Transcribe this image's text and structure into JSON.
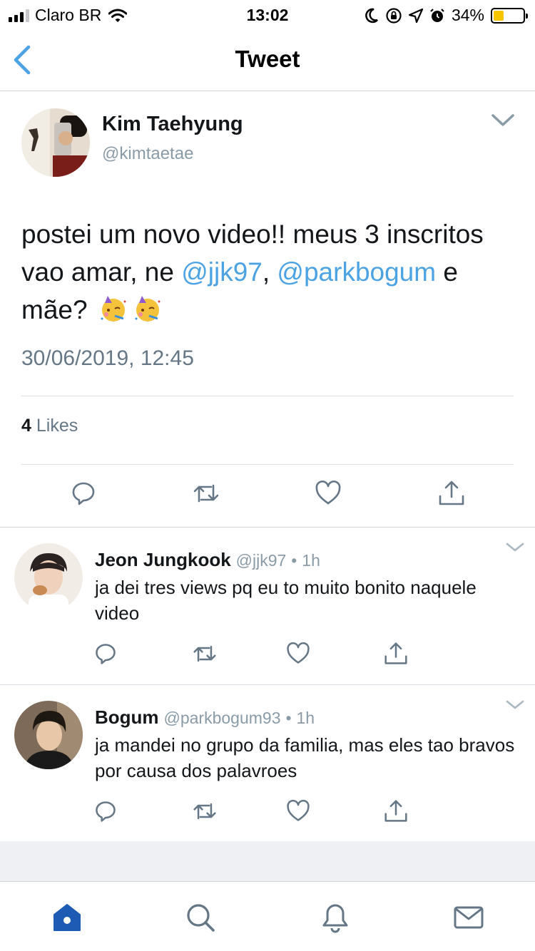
{
  "status_bar": {
    "carrier": "Claro BR",
    "time": "13:02",
    "battery_percent": "34%",
    "battery_level": 0.34
  },
  "nav": {
    "title": "Tweet"
  },
  "main_tweet": {
    "author_name": "Kim Taehyung",
    "author_handle": "@kimtaetae",
    "text_parts": {
      "p1": "postei um novo video!! meus 3 inscritos vao amar, ne ",
      "mention1": "@jjk97",
      "p2": ", ",
      "mention2": "@parkbogum",
      "p3": " e mãe?"
    },
    "emoji": "partying-face-emoji",
    "timestamp": "30/06/2019, 12:45",
    "likes_count": "4",
    "likes_label": "Likes"
  },
  "replies": [
    {
      "name": "Jeon Jungkook",
      "handle": "@jjk97",
      "time": "1h",
      "text": "ja dei tres views pq eu to muito bonito naquele video"
    },
    {
      "name": "Bogum",
      "handle": "@parkbogum93",
      "time": "1h",
      "text": "ja mandei no grupo da familia, mas eles tao bravos por causa dos palavroes"
    }
  ],
  "colors": {
    "accent": "#1da1f2",
    "mention": "#4ba3e3",
    "icon_gray": "#657786",
    "tab_active": "#1d5bb5"
  },
  "icons": [
    "reply-icon",
    "retweet-icon",
    "like-icon",
    "share-icon",
    "home-icon",
    "search-icon",
    "notifications-icon",
    "messages-icon"
  ]
}
